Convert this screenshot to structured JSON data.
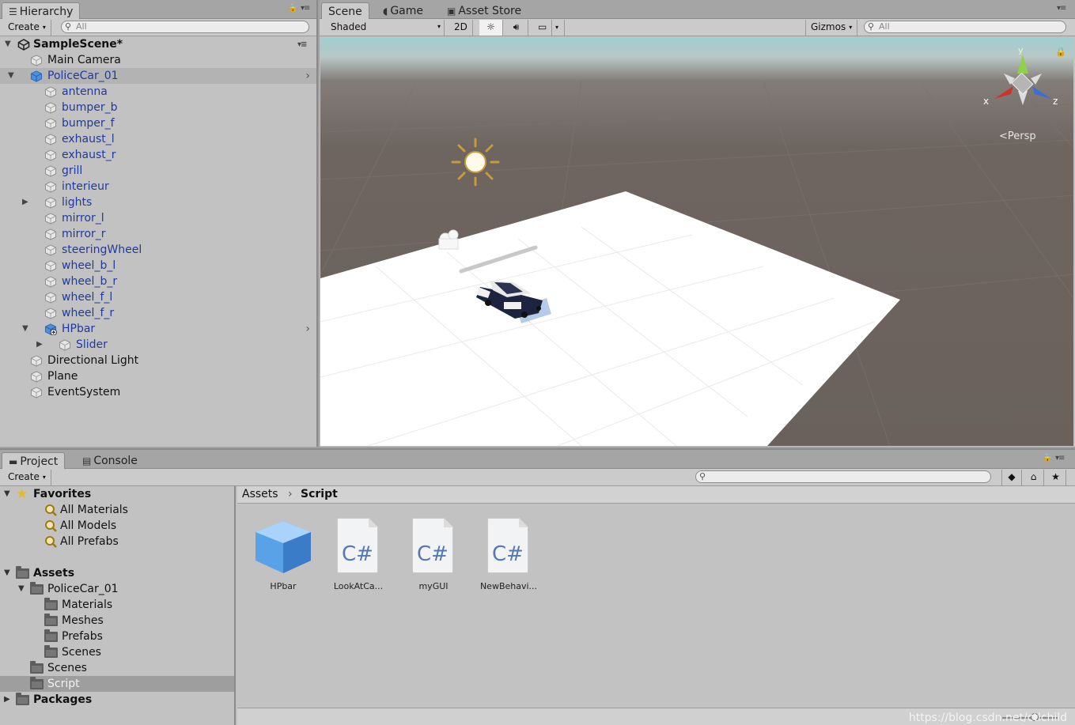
{
  "hierarchy": {
    "tab_label": "Hierarchy",
    "create_label": "Create",
    "search_placeholder": "All",
    "scene_name": "SampleScene*",
    "items": [
      {
        "label": "Main Camera",
        "depth": 1,
        "fold": "",
        "blue": false,
        "selected": false
      },
      {
        "label": "PoliceCar_01",
        "depth": 1,
        "fold": "open",
        "blue": true,
        "selected": true,
        "prefab": true,
        "chevron": true
      },
      {
        "label": "antenna",
        "depth": 2,
        "fold": "",
        "blue": true
      },
      {
        "label": "bumper_b",
        "depth": 2,
        "fold": "",
        "blue": true
      },
      {
        "label": "bumper_f",
        "depth": 2,
        "fold": "",
        "blue": true
      },
      {
        "label": "exhaust_l",
        "depth": 2,
        "fold": "",
        "blue": true
      },
      {
        "label": "exhaust_r",
        "depth": 2,
        "fold": "",
        "blue": true
      },
      {
        "label": "grill",
        "depth": 2,
        "fold": "",
        "blue": true
      },
      {
        "label": "interieur",
        "depth": 2,
        "fold": "",
        "blue": true
      },
      {
        "label": "lights",
        "depth": 2,
        "fold": "closed",
        "blue": true
      },
      {
        "label": "mirror_l",
        "depth": 2,
        "fold": "",
        "blue": true
      },
      {
        "label": "mirror_r",
        "depth": 2,
        "fold": "",
        "blue": true
      },
      {
        "label": "steeringWheel",
        "depth": 2,
        "fold": "",
        "blue": true
      },
      {
        "label": "wheel_b_l",
        "depth": 2,
        "fold": "",
        "blue": true
      },
      {
        "label": "wheel_b_r",
        "depth": 2,
        "fold": "",
        "blue": true
      },
      {
        "label": "wheel_f_l",
        "depth": 2,
        "fold": "",
        "blue": true
      },
      {
        "label": "wheel_f_r",
        "depth": 2,
        "fold": "",
        "blue": true
      },
      {
        "label": "HPbar",
        "depth": 2,
        "fold": "open",
        "blue": true,
        "prefab": true,
        "added": true,
        "chevron": true
      },
      {
        "label": "Slider",
        "depth": 3,
        "fold": "closed",
        "blue": true
      },
      {
        "label": "Directional Light",
        "depth": 1,
        "fold": "",
        "blue": false
      },
      {
        "label": "Plane",
        "depth": 1,
        "fold": "",
        "blue": false
      },
      {
        "label": "EventSystem",
        "depth": 1,
        "fold": "",
        "blue": false
      }
    ]
  },
  "scene": {
    "tabs": [
      "Scene",
      "Game",
      "Asset Store"
    ],
    "shading_mode": "Shaded",
    "mode_2d": "2D",
    "gizmos_label": "Gizmos",
    "search_placeholder": "All",
    "projection_label": "Persp",
    "axis_x": "x",
    "axis_y": "y",
    "axis_z": "z",
    "colors": {
      "x_axis": "#d0322b",
      "y_axis": "#8fd14a",
      "z_axis": "#3b6fd6"
    }
  },
  "project": {
    "tabs": [
      "Project",
      "Console"
    ],
    "create_label": "Create",
    "tree": [
      {
        "label": "Favorites",
        "depth": 0,
        "fold": "open",
        "icon": "star",
        "bold": true
      },
      {
        "label": "All Materials",
        "depth": 1,
        "icon": "search"
      },
      {
        "label": "All Models",
        "depth": 1,
        "icon": "search"
      },
      {
        "label": "All Prefabs",
        "depth": 1,
        "icon": "search"
      },
      {
        "label": "",
        "depth": 0,
        "icon": "none"
      },
      {
        "label": "Assets",
        "depth": 0,
        "fold": "open",
        "icon": "folder",
        "bold": true
      },
      {
        "label": "PoliceCar_01",
        "depth": 1,
        "fold": "open",
        "icon": "folder"
      },
      {
        "label": "Materials",
        "depth": 2,
        "icon": "folder"
      },
      {
        "label": "Meshes",
        "depth": 2,
        "icon": "folder"
      },
      {
        "label": "Prefabs",
        "depth": 2,
        "icon": "folder"
      },
      {
        "label": "Scenes",
        "depth": 2,
        "icon": "folder"
      },
      {
        "label": "Scenes",
        "depth": 1,
        "icon": "folder"
      },
      {
        "label": "Script",
        "depth": 1,
        "icon": "folder",
        "selected": true
      },
      {
        "label": "Packages",
        "depth": 0,
        "fold": "closed",
        "icon": "folder",
        "bold": true
      }
    ],
    "breadcrumb": [
      "Assets",
      "Script"
    ],
    "assets": [
      {
        "label": "HPbar",
        "type": "prefab"
      },
      {
        "label": "LookAtCa...",
        "type": "cs"
      },
      {
        "label": "myGUI",
        "type": "cs"
      },
      {
        "label": "NewBehavi...",
        "type": "cs"
      }
    ],
    "cs_glyph": "C#"
  },
  "watermark": "https://blog.csdn.net/ctlchild"
}
